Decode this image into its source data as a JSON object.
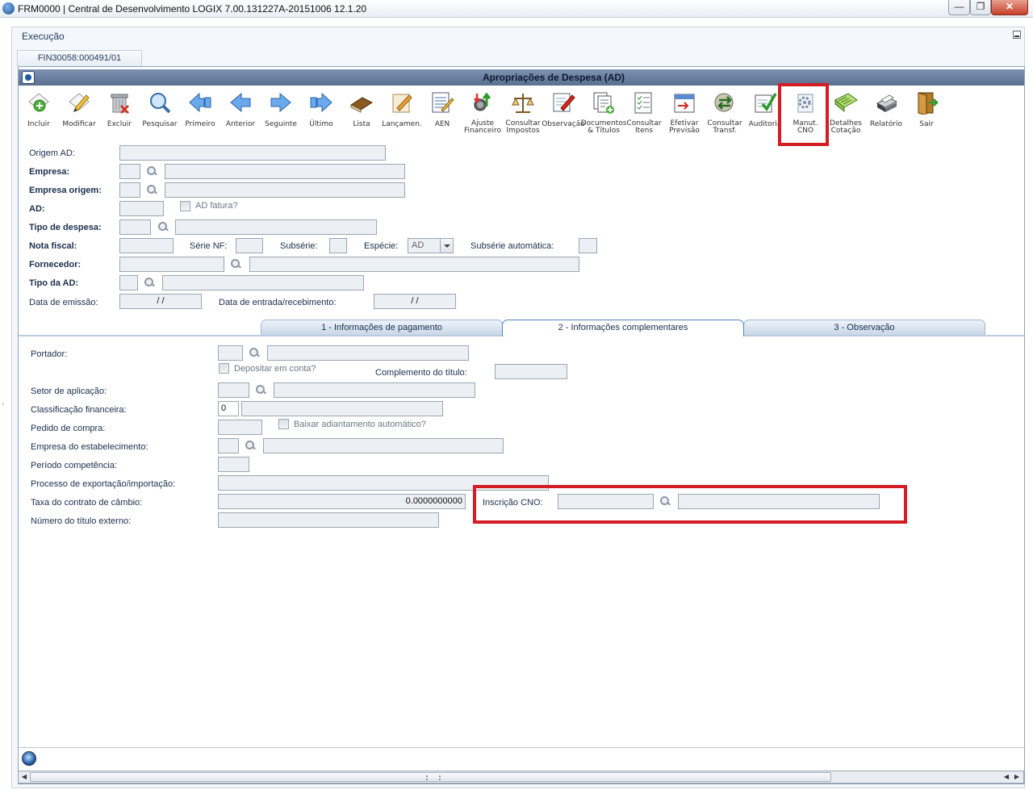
{
  "window": {
    "title": "FRM0000 | Central de Desenvolvimento LOGIX   7.00.131227A-20151006   12.1.20",
    "min": "—",
    "restore": "❐",
    "close": "✕"
  },
  "shell": {
    "exec_label": "Execução",
    "program_tab": "FIN30058:000491/01"
  },
  "form": {
    "title": "Apropriações de Despesa (AD)"
  },
  "toolbar": [
    {
      "label": "Incluir",
      "icon": "add-document-icon"
    },
    {
      "label": "Modificar",
      "icon": "edit-document-icon"
    },
    {
      "label": "Excluir",
      "icon": "trash-icon"
    },
    {
      "label": "Pesquisar",
      "icon": "magnifier-icon"
    },
    {
      "label": "Primeiro",
      "icon": "first-arrow-icon"
    },
    {
      "label": "Anterior",
      "icon": "previous-arrow-icon"
    },
    {
      "label": "Seguinte",
      "icon": "next-arrow-icon"
    },
    {
      "label": "Último",
      "icon": "last-arrow-icon"
    },
    {
      "label": "Lista",
      "icon": "book-icon"
    },
    {
      "label": "Lançamen.",
      "icon": "pencil-sheet-icon"
    },
    {
      "label": "AEN",
      "icon": "notes-pencil-icon"
    },
    {
      "label": "Ajuste\nFinanceiro",
      "icon": "coins-arrows-icon"
    },
    {
      "label": "Consultar\nImpostos",
      "icon": "scale-icon"
    },
    {
      "label": "Observação",
      "icon": "observation-pencil-icon"
    },
    {
      "label": "Documentos\n& Títulos",
      "icon": "documents-plus-icon"
    },
    {
      "label": "Consultar\nItens",
      "icon": "checklist-icon"
    },
    {
      "label": "Efetivar\nPrevisão",
      "icon": "calendar-arrow-icon"
    },
    {
      "label": "Consultar\nTransf.",
      "icon": "transfer-icon"
    },
    {
      "label": "Auditoria",
      "icon": "audit-check-icon"
    },
    {
      "label": "Manut.\nCNO",
      "icon": "cno-maintenance-icon"
    },
    {
      "label": "Detalhes\nCotação",
      "icon": "spreadsheet-icon"
    },
    {
      "label": "Relatório",
      "icon": "printer-icon"
    },
    {
      "label": "Sair",
      "icon": "exit-door-icon"
    }
  ],
  "header_fields": {
    "origem_ad": "Origem AD:",
    "empresa": "Empresa:",
    "empresa_origem": "Empresa origem:",
    "ad": "AD:",
    "ad_fatura": "AD fatura?",
    "tipo_despesa": "Tipo de despesa:",
    "nota_fiscal": "Nota fiscal:",
    "serie_nf": "Série NF:",
    "subserie": "Subsérie:",
    "especie": "Espécie:",
    "especie_value": "AD",
    "subserie_auto": "Subsérie automática:",
    "fornecedor": "Fornecedor:",
    "tipo_ad": "Tipo da AD:",
    "data_emissao": "Data de emissão:",
    "data_emissao_value": "/ /",
    "data_entrada": "Data de entrada/recebimento:",
    "data_entrada_value": "/ /"
  },
  "tabs": [
    {
      "label": "1 - Informações de pagamento"
    },
    {
      "label": "2 - Informações complementares"
    },
    {
      "label": "3 - Observação"
    }
  ],
  "complementares": {
    "portador": "Portador:",
    "depositar": "Depositar em conta?",
    "complemento": "Complemento do título:",
    "setor": "Setor de aplicação:",
    "classificacao": "Classificação financeira:",
    "classificacao_value": "0",
    "pedido": "Pedido de compra:",
    "baixar": "Baixar adiantamento automático?",
    "empresa_estab": "Empresa do estabelecimento:",
    "periodo": "Período competência:",
    "processo": "Processo de exportação/importação:",
    "taxa": "Taxa do contrato de câmbio:",
    "taxa_value": "0.0000000000",
    "numero_titulo": "Número do título externo:",
    "inscricao_cno": "Inscrição CNO:"
  },
  "colors": {
    "highlight": "#d41c25",
    "title_bar": "#6b809e"
  }
}
